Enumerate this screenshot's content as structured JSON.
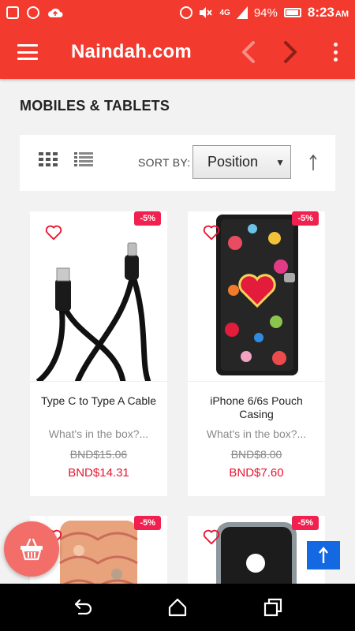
{
  "status_bar": {
    "battery": "94%",
    "network": "4G",
    "time": "8:23",
    "ampm": "AM"
  },
  "app_bar": {
    "title": "Naindah.com"
  },
  "page": {
    "title": "MOBILES & TABLETS"
  },
  "toolbar": {
    "sort_label": "SORT BY:",
    "sort_value": "Position"
  },
  "products": [
    {
      "name": "Type C to Type A Cable",
      "description": "What's in the box?...",
      "old_price": "BND$15.06",
      "new_price": "BND$14.31",
      "discount": "-5%"
    },
    {
      "name": "iPhone 6/6s Pouch Casing",
      "description": "What's in the box?...",
      "old_price": "BND$8.00",
      "new_price": "BND$7.60",
      "discount": "-5%"
    },
    {
      "discount": "-5%"
    },
    {
      "discount": "-5%"
    }
  ],
  "colors": {
    "brand": "#f33a2e",
    "discount": "#f0214f",
    "price": "#e8142f",
    "back_to_top": "#1469e3"
  },
  "icons": {
    "menu": "hamburger-icon",
    "prev": "chevron-left-icon",
    "next": "chevron-right-icon",
    "more": "kebab-icon",
    "grid": "grid-view-icon",
    "list": "list-view-icon",
    "wishlist": "heart-icon",
    "cart": "basket-icon",
    "top": "arrow-up-icon"
  }
}
